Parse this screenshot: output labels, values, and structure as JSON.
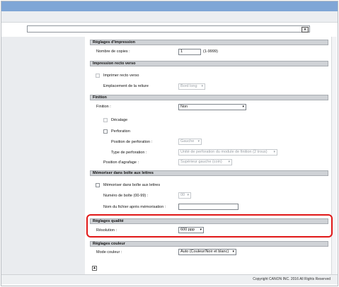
{
  "print_settings": {
    "section": "Réglages d'impression",
    "copies_label": "Nombre de copies :",
    "copies_value": "1",
    "copies_range": "(1-9999)"
  },
  "duplex": {
    "section": "Impression recto verso",
    "duplex_label": "Imprimer recto verso",
    "binding_label": "Emplacement de la reliure",
    "binding_value": "Bord long"
  },
  "finishing": {
    "section": "Finition",
    "finishing_label": "Finition :",
    "finishing_value": "Non",
    "offset_label": "Décalage",
    "punch_label": "Perforation",
    "punch_position_label": "Position de perforation :",
    "punch_position_value": "Gauche",
    "punch_type_label": "Type de perforation :",
    "punch_type_value": "Unité de perforation du module de finition (2 trous)",
    "staple_position_label": "Position d'agrafage :",
    "staple_position_value": "Supérieur gauche (coin)"
  },
  "mailbox": {
    "section": "Mémoriser dans boîte aux lettres",
    "store_label": "Mémoriser dans boîte aux lettres",
    "box_number_label": "Numéro de boîte (00-99) :",
    "box_number_value": "00",
    "file_name_label": "Nom du fichier après mémorisation :",
    "file_name_value": ""
  },
  "quality": {
    "section": "Réglages qualité",
    "resolution_label": "Résolution :",
    "resolution_value": "600 ppp"
  },
  "color": {
    "section": "Réglages couleur",
    "mode_label": "Mode couleur :",
    "mode_value": "Auto (Couleur/Noir et blanc)"
  },
  "top_select_value": "",
  "footer": {
    "copyright": "Copyright CANON INC. 2016 All Rights Reserved"
  },
  "icons": {
    "dropdown": "▾",
    "collapse": "▲"
  }
}
